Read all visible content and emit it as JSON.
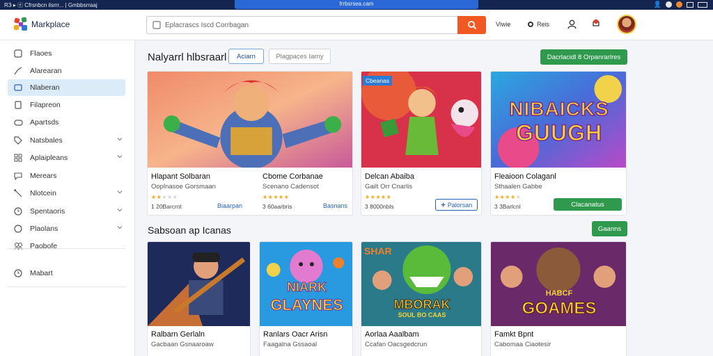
{
  "os_bar": {
    "left_text": "RЗ ▸  ⓔ Cfrsnbcn ilsrrr... | Gmbbsrraaj",
    "url": "frrbsrsea.cam"
  },
  "header": {
    "brand": "Markplace",
    "search_placeholder": "Eplacrascs Iscd Corrbagan",
    "nav": [
      {
        "label": "Viwie",
        "icon": "user-icon"
      },
      {
        "label": "Reis",
        "icon": "globe-icon"
      }
    ],
    "colors": {
      "search_button": "#f05a22",
      "accent": "#2a62b8",
      "green": "#2f9a4e"
    }
  },
  "sidebar": {
    "items": [
      {
        "label": "Flaoes",
        "icon": "home-icon",
        "chevron": false
      },
      {
        "label": "Alarearan",
        "icon": "trending-icon",
        "chevron": false
      },
      {
        "label": "Nlaberan",
        "icon": "folder-icon",
        "chevron": false,
        "active": true
      },
      {
        "label": "Filapreon",
        "icon": "document-icon",
        "chevron": false
      },
      {
        "label": "Apartsds",
        "icon": "gamepad-icon",
        "chevron": false
      },
      {
        "label": "Natsbales",
        "icon": "tag-icon",
        "chevron": true
      },
      {
        "label": "Aplaipleans",
        "icon": "grid-icon",
        "chevron": true
      },
      {
        "label": "Merears",
        "icon": "chat-icon",
        "chevron": false
      },
      {
        "label": "Nlotcein",
        "icon": "box-icon",
        "chevron": true
      },
      {
        "label": "Spentaoris",
        "icon": "clock-icon",
        "chevron": true
      },
      {
        "label": "Plaolans",
        "icon": "shield-icon",
        "chevron": true
      },
      {
        "label": "Paobofe",
        "icon": "people-icon",
        "chevron": false
      }
    ],
    "footer_item": {
      "label": "Mabart",
      "icon": "clock-icon"
    }
  },
  "section1": {
    "title": "Nalyarrl hlbsraarl",
    "tabs": [
      "Aciarn",
      "Plagpaces  Iarny"
    ],
    "action": "Dacrlacidl 8 Orpanrarlres",
    "cards": [
      {
        "name": "Hlapant Solbaran",
        "sub": "Ooplnasoe Gorsmaan",
        "stars": 2,
        "price": "1 20Barcrnt",
        "link": "Biaarpan"
      },
      {
        "name": "Cbome Corbanae",
        "sub": "Scenano Cadensot",
        "stars": 5,
        "price": "3 60aarbris",
        "link": "Basnans"
      },
      {
        "name": "Delcan Abaiba",
        "sub": "Gailt Orr Cnarlis",
        "stars": 5,
        "price": "3 8000nbls",
        "button": "Palorsan",
        "badge": "Cbeanas",
        "sub_note": "∞"
      },
      {
        "name": "Fleaioon Colaganl",
        "sub": "Sthaalen Gabbe",
        "stars": 4,
        "price": "3 3Barlcnl",
        "button": "Clacanatus"
      }
    ]
  },
  "section2": {
    "title": "Sabsoan ap Icanas",
    "action": "Gaanns",
    "cards": [
      {
        "name": "Ralbarn Gerlaln",
        "sub": "Gacbaan Gsnaaroaw"
      },
      {
        "name": "Ranlars Oacr Arisn",
        "sub": "Faagalna Gssaoal"
      },
      {
        "name": "Aorlaa Aaalbam",
        "sub": "Ccafan Oacsgedcrun",
        "art_text": [
          "SHAR",
          "MBORAK",
          "SOUL BO CAAS"
        ]
      },
      {
        "name": "Famkt Bpnt",
        "sub": "Cabomaa Ciaotesir",
        "art_text": [
          "HABCF",
          "GOAMES"
        ]
      }
    ]
  },
  "art_text": {
    "card3": [
      "NIBAICKS",
      "GUUGH"
    ],
    "s2card2": [
      "NIARK",
      "GLAYNES"
    ]
  }
}
